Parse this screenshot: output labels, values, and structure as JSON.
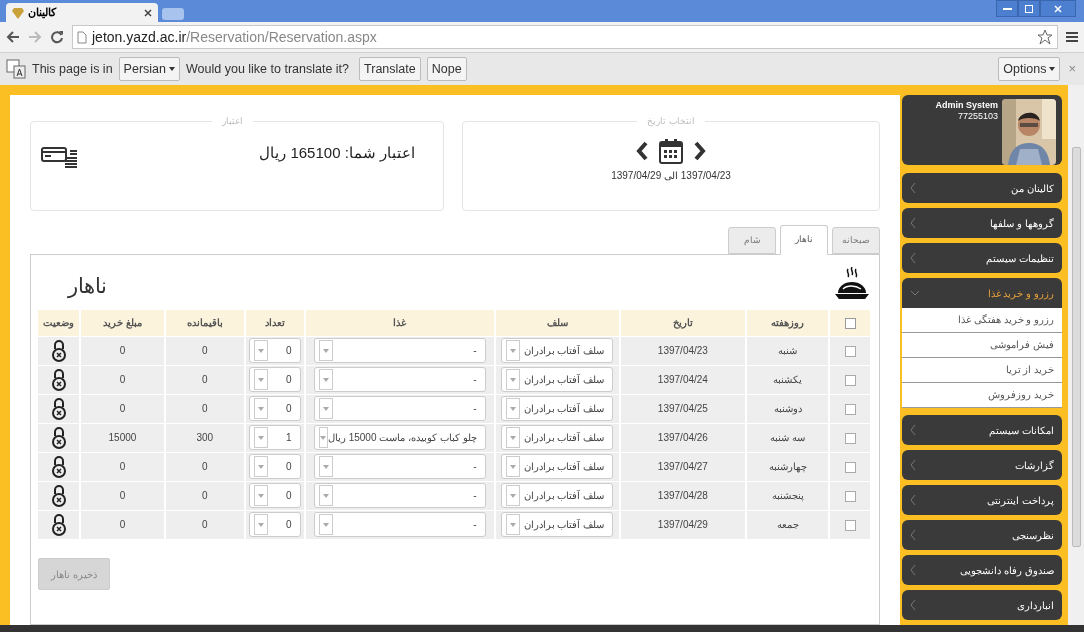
{
  "browser": {
    "tab_title": "کالینان",
    "url_host": "jeton.yazd.ac.ir",
    "url_path": "/Reservation/Reservation.aspx"
  },
  "translate_bar": {
    "prefix": "This page is in",
    "language": "Persian",
    "question": "Would you like to translate it?",
    "translate_button": "Translate",
    "nope_button": "Nope",
    "options_button": "Options",
    "close": "×"
  },
  "user": {
    "name": "Admin System",
    "id": "77255103"
  },
  "sidebar": {
    "items": [
      {
        "label": "کالینان من",
        "expanded": false
      },
      {
        "label": "گروهها و سلفها",
        "expanded": false
      },
      {
        "label": "تنظیمات سیستم",
        "expanded": false
      },
      {
        "label": "رزرو و خرید غذا",
        "expanded": true,
        "children": [
          {
            "label": "رزرو و خرید هفتگی غذا"
          },
          {
            "label": "فیش فراموشی"
          },
          {
            "label": "خرید از تریا"
          },
          {
            "label": "خرید روزفروش"
          }
        ]
      },
      {
        "label": "امکانات سیستم",
        "expanded": false
      },
      {
        "label": "گزارشات",
        "expanded": false
      },
      {
        "label": "پرداخت اینترنتی",
        "expanded": false
      },
      {
        "label": "نظرسنجی",
        "expanded": false
      },
      {
        "label": "صندوق رفاه دانشجویی",
        "expanded": false
      },
      {
        "label": "انبارداری",
        "expanded": false
      }
    ]
  },
  "date_picker": {
    "legend": "انتخاب تاریخ",
    "range": "1397/04/23 الی 1397/04/29"
  },
  "credit": {
    "legend": "اعتبار",
    "text": "اعتبار شما: 165100 ریال"
  },
  "tabs": [
    {
      "label": "صبحانه",
      "selected": false
    },
    {
      "label": "ناهار",
      "selected": true
    },
    {
      "label": "شام",
      "selected": false
    }
  ],
  "panel_title": "ناهار",
  "table": {
    "select_all": false,
    "columns": [
      "روزهفته",
      "تاریخ",
      "سلف",
      "غذا",
      "تعداد",
      "باقیمانده",
      "مبلغ خرید",
      "وضعیت"
    ],
    "rows": [
      {
        "checked": false,
        "day": "شنبه",
        "date": "1397/04/23",
        "self": "سلف آفتاب برادران",
        "food": "-",
        "count": "0",
        "remaining": "0",
        "amount": "0"
      },
      {
        "checked": false,
        "day": "یکشنبه",
        "date": "1397/04/24",
        "self": "سلف آفتاب برادران",
        "food": "-",
        "count": "0",
        "remaining": "0",
        "amount": "0"
      },
      {
        "checked": false,
        "day": "دوشنبه",
        "date": "1397/04/25",
        "self": "سلف آفتاب برادران",
        "food": "-",
        "count": "0",
        "remaining": "0",
        "amount": "0"
      },
      {
        "checked": false,
        "day": "سه شنبه",
        "date": "1397/04/26",
        "self": "سلف آفتاب برادران",
        "food": "چلو کباب کوبیده، ماست 15000 ریال",
        "count": "1",
        "remaining": "300",
        "amount": "15000"
      },
      {
        "checked": false,
        "day": "چهارشنبه",
        "date": "1397/04/27",
        "self": "سلف آفتاب برادران",
        "food": "-",
        "count": "0",
        "remaining": "0",
        "amount": "0"
      },
      {
        "checked": false,
        "day": "پنجشنبه",
        "date": "1397/04/28",
        "self": "سلف آفتاب برادران",
        "food": "-",
        "count": "0",
        "remaining": "0",
        "amount": "0"
      },
      {
        "checked": false,
        "day": "جمعه",
        "date": "1397/04/29",
        "self": "سلف آفتاب برادران",
        "food": "-",
        "count": "0",
        "remaining": "0",
        "amount": "0"
      }
    ]
  },
  "save_button": {
    "label": "ذخیره ناهار",
    "disabled": true
  }
}
